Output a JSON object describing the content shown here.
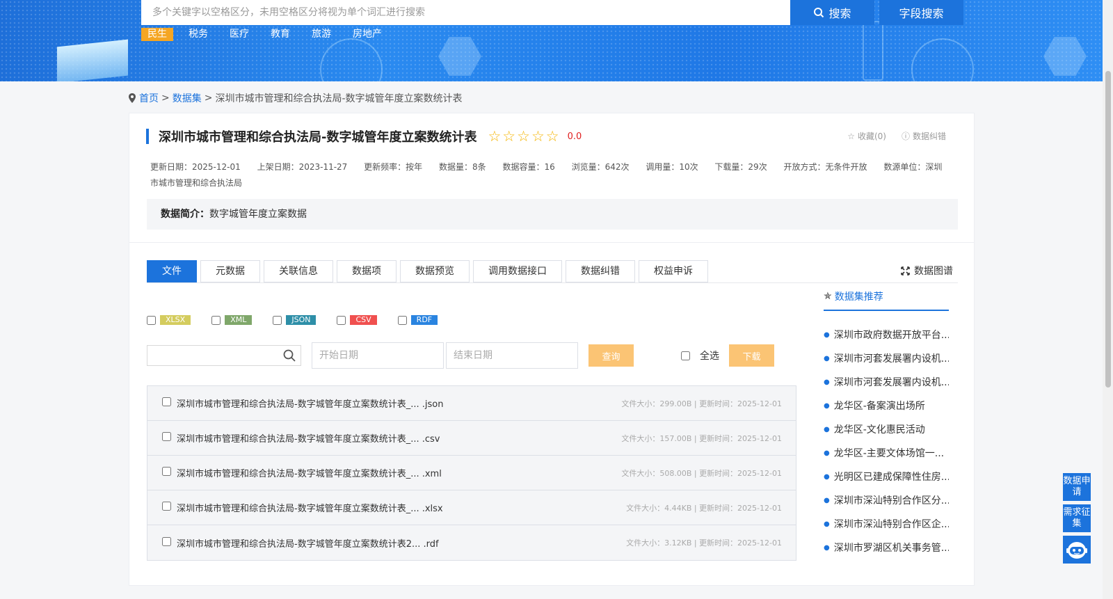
{
  "header": {
    "search_placeholder": "多个关键字以空格区分，未用空格区分将视为单个词汇进行搜索",
    "search_button": "搜索",
    "field_search_button": "字段搜索",
    "hot_tags": [
      "民生",
      "税务",
      "医疗",
      "教育",
      "旅游",
      "房地产"
    ]
  },
  "breadcrumb": {
    "home": "首页",
    "sep": ">",
    "datasets": "数据集",
    "current": "深圳市城市管理和综合执法局-数字城管年度立案数统计表"
  },
  "dataset": {
    "title": "深圳市城市管理和综合执法局-数字城管年度立案数统计表",
    "rating": "0.0",
    "rating_stars": 0,
    "favorite": "收藏(0)",
    "error_report": "数据纠错",
    "meta": [
      "更新日期：2025-12-01",
      "上架日期：2023-11-27",
      "更新频率：按年",
      "数据量：8条",
      "数据容量：16",
      "浏览量：642次",
      "调用量：10次",
      "下载量：29次",
      "开放方式：无条件开放",
      "数源单位：深圳市城市管理和综合执法局"
    ],
    "intro_label": "数据简介：",
    "intro_text": "数字城管年度立案数据"
  },
  "tabs": [
    "文件",
    "元数据",
    "关联信息",
    "数据项",
    "数据预览",
    "调用数据接口",
    "数据纠错",
    "权益申诉"
  ],
  "graph_link": "数据图谱",
  "formats": [
    {
      "label": "XLSX",
      "color": "#d4cc5e"
    },
    {
      "label": "XML",
      "color": "#7fa76a"
    },
    {
      "label": "JSON",
      "color": "#2e8fa8"
    },
    {
      "label": "CSV",
      "color": "#f0504f"
    },
    {
      "label": "RDF",
      "color": "#2a84e0"
    }
  ],
  "filter": {
    "start_date_placeholder": "开始日期",
    "end_date_placeholder": "结束日期",
    "query_button": "查询",
    "select_all": "全选",
    "download_button": "下载"
  },
  "files": [
    {
      "name": "深圳市城市管理和综合执法局-数字城管年度立案数统计表_... .json",
      "info": "文件大小：299.00B | 更新时间：2025-12-01"
    },
    {
      "name": "深圳市城市管理和综合执法局-数字城管年度立案数统计表_... .csv",
      "info": "文件大小：157.00B | 更新时间：2025-12-01"
    },
    {
      "name": "深圳市城市管理和综合执法局-数字城管年度立案数统计表_... .xml",
      "info": "文件大小：508.00B | 更新时间：2025-12-01"
    },
    {
      "name": "深圳市城市管理和综合执法局-数字城管年度立案数统计表_... .xlsx",
      "info": "文件大小：4.44KB | 更新时间：2025-12-01"
    },
    {
      "name": "深圳市城市管理和综合执法局-数字城管年度立案数统计表2... .rdf",
      "info": "文件大小：3.12KB | 更新时间：2025-12-01"
    }
  ],
  "recommend": {
    "title": "数据集推荐",
    "items": [
      "深圳市政府数据开放平台...",
      "深圳市河套发展署内设机...",
      "深圳市河套发展署内设机...",
      "龙华区-备案演出场所",
      "龙华区-文化惠民活动",
      "龙华区-主要文体场馆一...",
      "光明区已建成保障性住房...",
      "深圳市深汕特别合作区分...",
      "深圳市深汕特别合作区企...",
      "深圳市罗湖区机关事务管..."
    ]
  },
  "float": {
    "apply": "数据申请",
    "demand": "需求征集"
  },
  "colors": {
    "primary": "#1c73dc",
    "accent_orange": "#f5a623",
    "button_orange": "#fbc474",
    "rating_red": "#e02020"
  }
}
